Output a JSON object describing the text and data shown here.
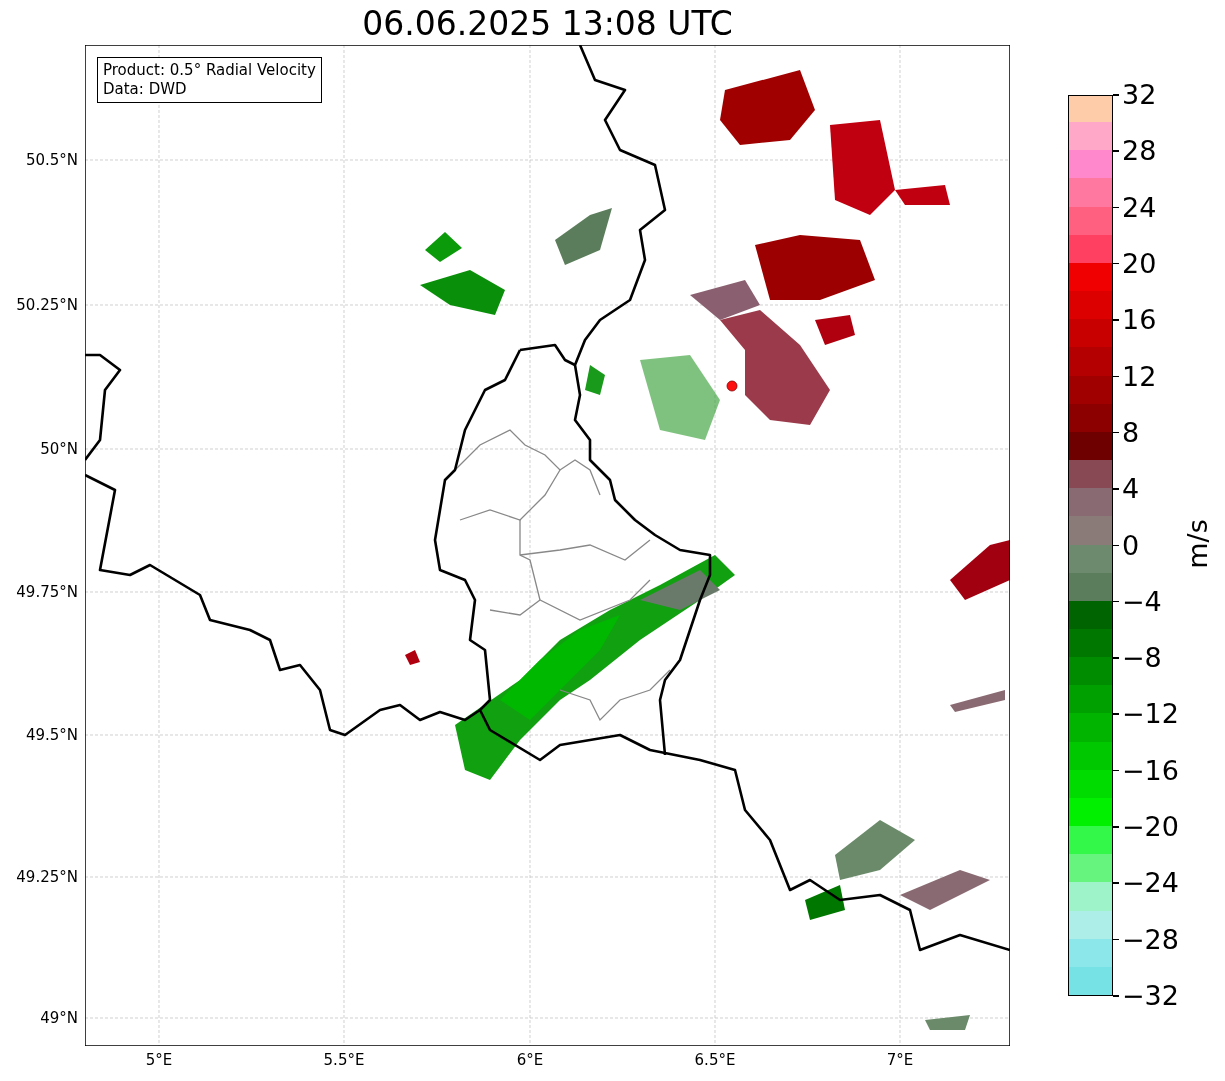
{
  "title": "06.06.2025 13:08 UTC",
  "info_box": {
    "lines": [
      "Product: 0.5° Radial Velocity",
      "Data: DWD"
    ]
  },
  "map": {
    "kind": "map",
    "y_ticks": [
      "50.5°N",
      "50.25°N",
      "50°N",
      "49.75°N",
      "49.5°N",
      "49.25°N",
      "49°N"
    ],
    "x_ticks": [
      "5°E",
      "5.5°E",
      "6°E",
      "6.5°E",
      "7°E"
    ]
  },
  "colorbar": {
    "label": "m/s",
    "ticks": [
      "32",
      "28",
      "24",
      "20",
      "16",
      "12",
      "8",
      "4",
      "0",
      "−4",
      "−8",
      "−12",
      "−16",
      "−20",
      "−24",
      "−28",
      "−32"
    ],
    "segments": [
      {
        "color": "#76e2e6"
      },
      {
        "color": "#8be7ea"
      },
      {
        "color": "#aeeee8"
      },
      {
        "color": "#9ef3c8"
      },
      {
        "color": "#66f47e"
      },
      {
        "color": "#33f84a"
      },
      {
        "color": "#00f000"
      },
      {
        "color": "#00dc00"
      },
      {
        "color": "#00c800"
      },
      {
        "color": "#00b400"
      },
      {
        "color": "#00a000"
      },
      {
        "color": "#008c00"
      },
      {
        "color": "#007800"
      },
      {
        "color": "#006400"
      },
      {
        "color": "#5b7d5b"
      },
      {
        "color": "#6e8a6e"
      },
      {
        "color": "#8a7a78"
      },
      {
        "color": "#8a6a72"
      },
      {
        "color": "#884955"
      },
      {
        "color": "#6e0000"
      },
      {
        "color": "#8c0000"
      },
      {
        "color": "#a00000"
      },
      {
        "color": "#b40000"
      },
      {
        "color": "#c80000"
      },
      {
        "color": "#dc0000"
      },
      {
        "color": "#f00000"
      },
      {
        "color": "#ff4060"
      },
      {
        "color": "#ff6080"
      },
      {
        "color": "#ff78a0"
      },
      {
        "color": "#ff88cc"
      },
      {
        "color": "#ffa8c8"
      },
      {
        "color": "#ffccaa"
      }
    ]
  }
}
